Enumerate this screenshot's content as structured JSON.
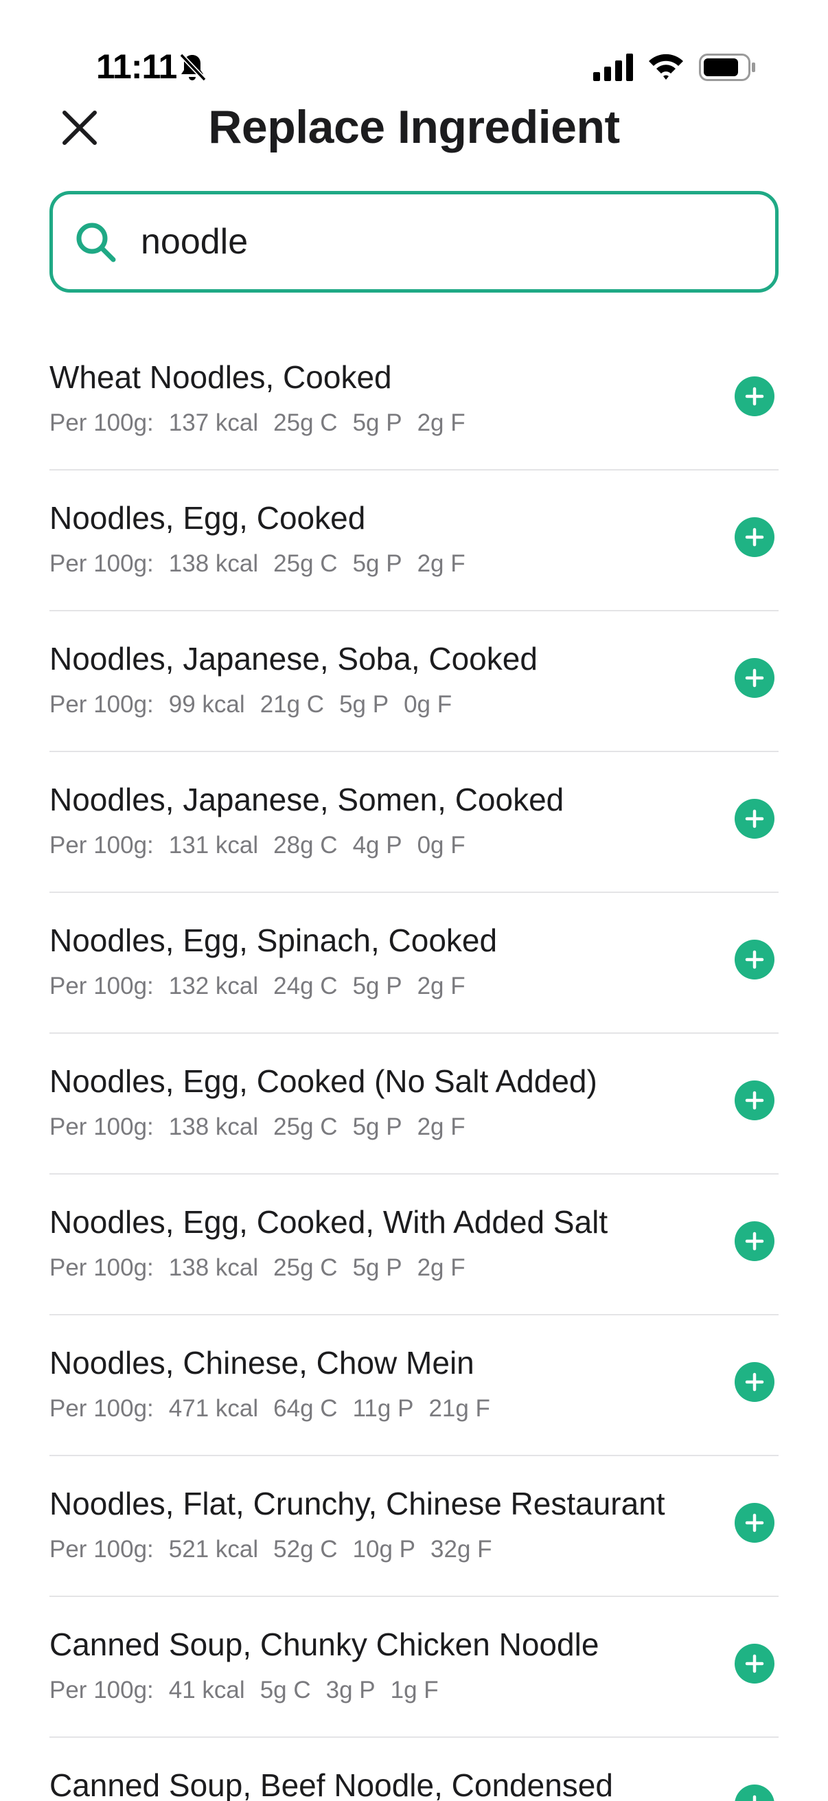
{
  "status": {
    "time": "11:11"
  },
  "header": {
    "title": "Replace Ingredient"
  },
  "search": {
    "value": "noodle"
  },
  "colors": {
    "accent": "#1fa985",
    "add_button": "#1fb384",
    "muted_text": "#7a7a7e"
  },
  "results": [
    {
      "name": "Wheat Noodles, Cooked",
      "prefix": "Per 100g:",
      "kcal": "137 kcal",
      "carbs": "25g C",
      "protein": "5g P",
      "fat": "2g F"
    },
    {
      "name": "Noodles, Egg, Cooked",
      "prefix": "Per 100g:",
      "kcal": "138 kcal",
      "carbs": "25g C",
      "protein": "5g P",
      "fat": "2g F"
    },
    {
      "name": "Noodles, Japanese, Soba, Cooked",
      "prefix": "Per 100g:",
      "kcal": "99 kcal",
      "carbs": "21g C",
      "protein": "5g P",
      "fat": "0g F"
    },
    {
      "name": "Noodles, Japanese, Somen, Cooked",
      "prefix": "Per 100g:",
      "kcal": "131 kcal",
      "carbs": "28g C",
      "protein": "4g P",
      "fat": "0g F"
    },
    {
      "name": "Noodles, Egg, Spinach, Cooked",
      "prefix": "Per 100g:",
      "kcal": "132 kcal",
      "carbs": "24g C",
      "protein": "5g P",
      "fat": "2g F"
    },
    {
      "name": "Noodles, Egg, Cooked (No Salt Added)",
      "prefix": "Per 100g:",
      "kcal": "138 kcal",
      "carbs": "25g C",
      "protein": "5g P",
      "fat": "2g F"
    },
    {
      "name": "Noodles, Egg, Cooked, With Added Salt",
      "prefix": "Per 100g:",
      "kcal": "138 kcal",
      "carbs": "25g C",
      "protein": "5g P",
      "fat": "2g F"
    },
    {
      "name": "Noodles, Chinese, Chow Mein",
      "prefix": "Per 100g:",
      "kcal": "471 kcal",
      "carbs": "64g C",
      "protein": "11g P",
      "fat": "21g F"
    },
    {
      "name": "Noodles, Flat, Crunchy, Chinese Restaurant",
      "prefix": "Per 100g:",
      "kcal": "521 kcal",
      "carbs": "52g C",
      "protein": "10g P",
      "fat": "32g F"
    },
    {
      "name": "Canned Soup, Chunky Chicken Noodle",
      "prefix": "Per 100g:",
      "kcal": "41 kcal",
      "carbs": "5g C",
      "protein": "3g P",
      "fat": "1g F"
    },
    {
      "name": "Canned Soup, Beef Noodle, Condensed",
      "prefix": "",
      "kcal": "",
      "carbs": "",
      "protein": "",
      "fat": ""
    }
  ]
}
